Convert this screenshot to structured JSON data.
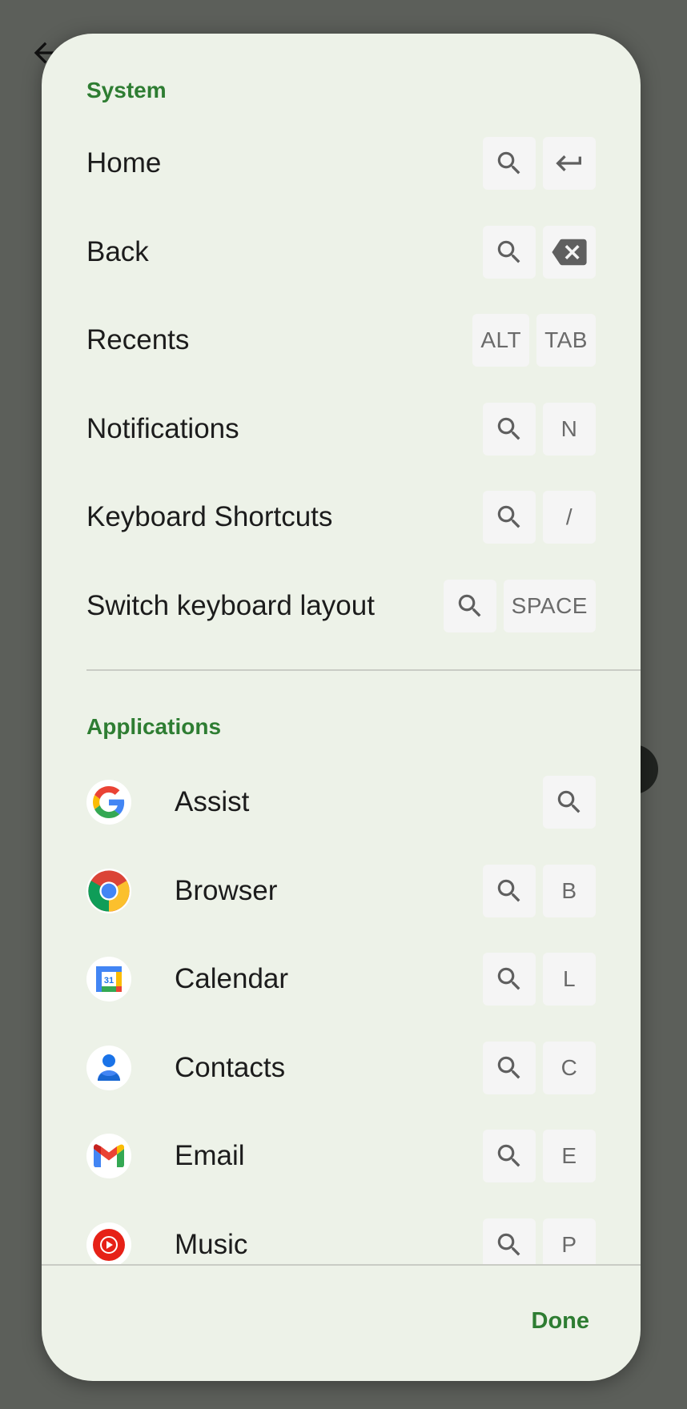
{
  "dialog": {
    "system_title": "System",
    "applications_title": "Applications",
    "done_label": "Done"
  },
  "system": [
    {
      "label": "Home",
      "keys": [
        {
          "type": "icon",
          "icon": "search-icon"
        },
        {
          "type": "icon",
          "icon": "enter-arrow-icon"
        }
      ]
    },
    {
      "label": "Back",
      "keys": [
        {
          "type": "icon",
          "icon": "search-icon"
        },
        {
          "type": "icon",
          "icon": "backspace-icon"
        }
      ]
    },
    {
      "label": "Recents",
      "keys": [
        {
          "type": "text",
          "text": "ALT"
        },
        {
          "type": "text",
          "text": "TAB"
        }
      ]
    },
    {
      "label": "Notifications",
      "keys": [
        {
          "type": "icon",
          "icon": "search-icon"
        },
        {
          "type": "text",
          "text": "N"
        }
      ]
    },
    {
      "label": "Keyboard Shortcuts",
      "keys": [
        {
          "type": "icon",
          "icon": "search-icon"
        },
        {
          "type": "text",
          "text": "/"
        }
      ]
    },
    {
      "label": "Switch keyboard layout",
      "keys": [
        {
          "type": "icon",
          "icon": "search-icon"
        },
        {
          "type": "text",
          "text": "SPACE"
        }
      ]
    }
  ],
  "applications": [
    {
      "label": "Assist",
      "icon": "google-icon",
      "keys": [
        {
          "type": "icon",
          "icon": "search-icon"
        }
      ]
    },
    {
      "label": "Browser",
      "icon": "chrome-icon",
      "keys": [
        {
          "type": "icon",
          "icon": "search-icon"
        },
        {
          "type": "text",
          "text": "B"
        }
      ]
    },
    {
      "label": "Calendar",
      "icon": "calendar-icon",
      "calendar_day": "31",
      "keys": [
        {
          "type": "icon",
          "icon": "search-icon"
        },
        {
          "type": "text",
          "text": "L"
        }
      ]
    },
    {
      "label": "Contacts",
      "icon": "contacts-icon",
      "keys": [
        {
          "type": "icon",
          "icon": "search-icon"
        },
        {
          "type": "text",
          "text": "C"
        }
      ]
    },
    {
      "label": "Email",
      "icon": "gmail-icon",
      "keys": [
        {
          "type": "icon",
          "icon": "search-icon"
        },
        {
          "type": "text",
          "text": "E"
        }
      ]
    },
    {
      "label": "Music",
      "icon": "youtube-music-icon",
      "keys": [
        {
          "type": "icon",
          "icon": "search-icon"
        },
        {
          "type": "text",
          "text": "P"
        }
      ]
    }
  ],
  "colors": {
    "accent": "#2e7d32",
    "dialog_bg": "#edf2e8",
    "key_bg": "#f5f5f5",
    "scrim": "#5c5f5a"
  }
}
